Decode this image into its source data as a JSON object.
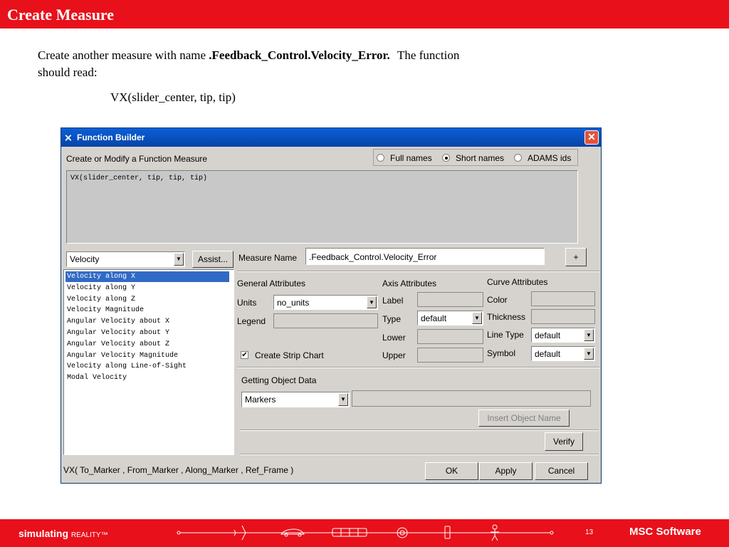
{
  "slide": {
    "title": "Create Measure",
    "instruction_prefix": "Create another measure with name",
    "instruction_name": ".Feedback_Control.Velocity_Error.",
    "instruction_suffix": "The function",
    "instruction_line2": "should read:",
    "function_text": "VX(slider_center, tip, tip)"
  },
  "window": {
    "title": "Function Builder",
    "section_label": "Create or Modify a Function Measure",
    "name_mode": {
      "options": [
        "Full names",
        "Short names",
        "ADAMS ids"
      ],
      "selected": "Short names"
    },
    "expression": "VX(slider_center, tip, tip, tip)",
    "category_combo": "Velocity",
    "assist_button": "Assist...",
    "function_list": [
      "Velocity along X",
      "Velocity along Y",
      "Velocity along Z",
      "Velocity Magnitude",
      "Angular Velocity about X",
      "Angular Velocity about Y",
      "Angular Velocity about Z",
      "Angular Velocity Magnitude",
      "Velocity along Line-of-Sight",
      "Modal Velocity"
    ],
    "selected_function": "Velocity along X",
    "measure_name_label": "Measure Name",
    "measure_name_value": ".Feedback_Control.Velocity_Error",
    "plus_button": "+",
    "general": {
      "heading": "General Attributes",
      "units_label": "Units",
      "units_value": "no_units",
      "legend_label": "Legend",
      "strip_chart_label": "Create Strip Chart",
      "strip_chart_checked": true
    },
    "axis": {
      "heading": "Axis Attributes",
      "label_label": "Label",
      "type_label": "Type",
      "type_value": "default",
      "lower_label": "Lower",
      "upper_label": "Upper"
    },
    "curve": {
      "heading": "Curve Attributes",
      "color_label": "Color",
      "thickness_label": "Thickness",
      "line_type_label": "Line Type",
      "line_type_value": "default",
      "symbol_label": "Symbol",
      "symbol_value": "default"
    },
    "object_data": {
      "heading": "Getting Object Data",
      "type_value": "Markers",
      "insert_button": "Insert Object Name"
    },
    "verify_button": "Verify",
    "signature": "VX( To_Marker , From_Marker , Along_Marker , Ref_Frame )",
    "ok_button": "OK",
    "apply_button": "Apply",
    "cancel_button": "Cancel"
  },
  "footer": {
    "brand_bold": "simulating",
    "brand_rest": "REALITY™",
    "page_number": "13",
    "logo": "MSC Software"
  },
  "colors": {
    "slide_red": "#e8101a",
    "titlebar_blue": "#0a5fd8",
    "dialog_gray": "#d6d3ce",
    "selection_blue": "#316ac5"
  }
}
